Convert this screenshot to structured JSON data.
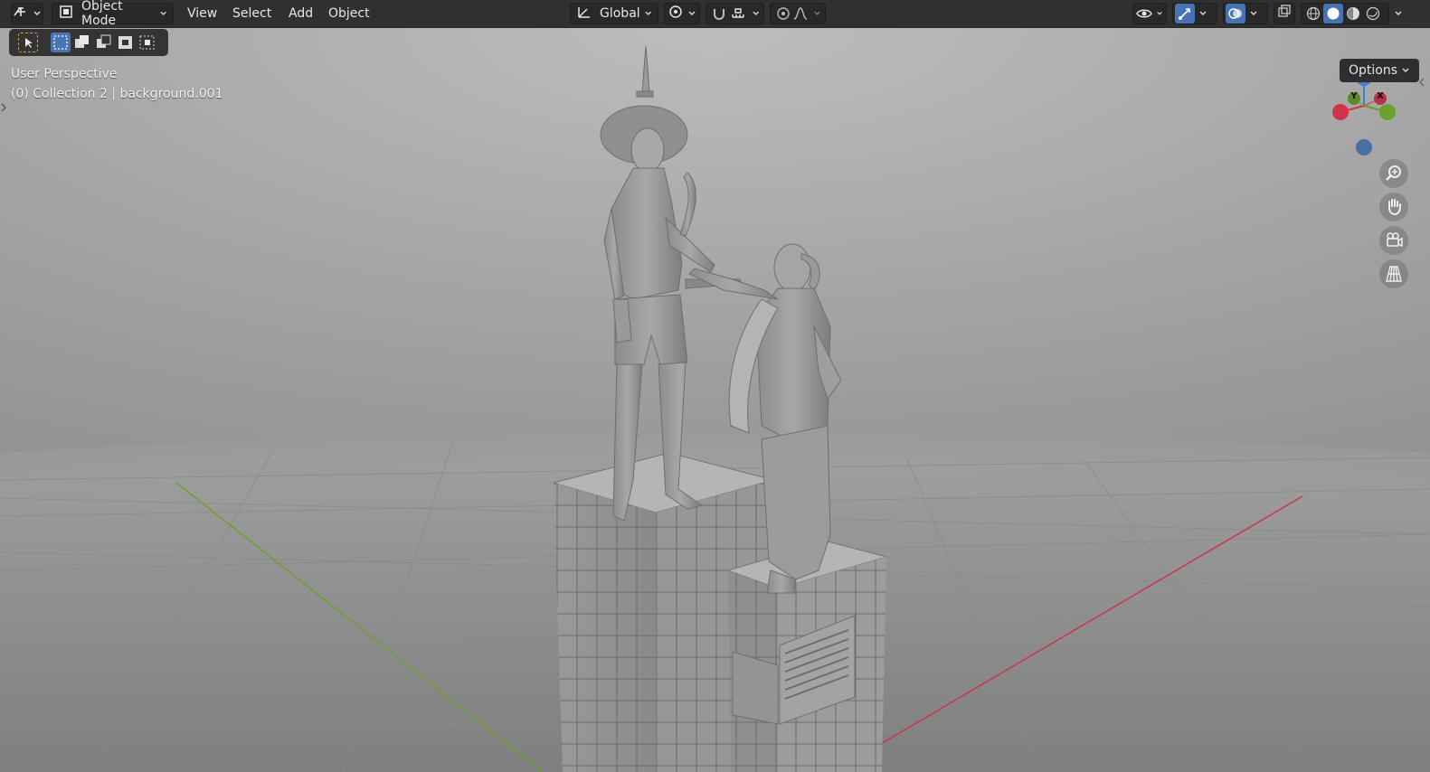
{
  "header": {
    "editor_type_icon": "viewport-editor-icon",
    "mode_label": "Object Mode",
    "menus": [
      "View",
      "Select",
      "Add",
      "Object"
    ],
    "orientation_label": "Global"
  },
  "viewport": {
    "perspective_label": "User Perspective",
    "collection_label": "(0) Collection 2 | background.001",
    "options_label": "Options"
  },
  "gizmo": {
    "z_label": "Z",
    "y_label": "Y",
    "x_label": "X"
  },
  "colors": {
    "accent": "#4772b3",
    "x_axis": "#d0344b",
    "y_axis": "#6aa12d",
    "z_axis": "#3b7fd8"
  }
}
